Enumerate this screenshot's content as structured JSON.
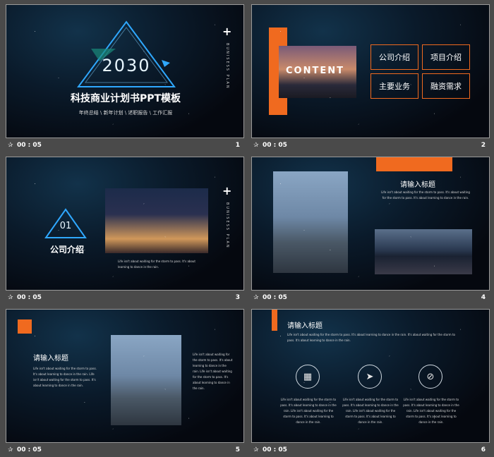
{
  "slides": [
    {
      "number": "1",
      "time": "00 : 05",
      "year": "2030",
      "title": "科技商业计划书PPT模板",
      "subtitle": "年终总结 \\ 新年计划 \\ 述职报告 \\ 工作汇报",
      "vertical": "BUNISESS PLAN"
    },
    {
      "number": "2",
      "time": "00 : 05",
      "content_label": "CONTENT",
      "menu": [
        "公司介绍",
        "项目介绍",
        "主要业务",
        "融资需求"
      ]
    },
    {
      "number": "3",
      "time": "00 : 05",
      "index": "01",
      "section": "公司介绍",
      "vertical": "BUNISESS PLAN",
      "body": "Life isn't about waiting for the storm to pass. It's about learning to dance in the rain."
    },
    {
      "number": "4",
      "time": "00 : 05",
      "heading": "请输入标题",
      "body": "Life isn't about waiting for the storm to pass. It's about waiting for the storm to pass. It's about learning to dance in the rain."
    },
    {
      "number": "5",
      "time": "00 : 05",
      "heading": "请输入标题",
      "left_body": "Life isn't about waiting for the storm to pass. It's about learning to dance in the rain. Life isn't about waiting for the storm to pass. It's about learning to dance in the rain.",
      "right_body": "Life isn't about waiting for the storm to pass. It's about learning to dance in the rain. Life isn't about waiting for the storm to pass. It's about learning to dance in the rain."
    },
    {
      "number": "6",
      "time": "00 : 05",
      "heading": "请输入标题",
      "intro": "Life isn't about waiting for the storm to pass. It's about learning to dance in the rain. It's about waiting for the storm to pass. It's about learning to dance in the rain.",
      "columns": [
        {
          "icon": "calculator-icon",
          "glyph": "▦",
          "text": "Life isn't about waiting for the storm to pass. It's about learning to dance in the rain. Life isn't about waiting for the storm to pass. It's about learning to dance in the rain."
        },
        {
          "icon": "paper-plane-icon",
          "glyph": "➤",
          "text": "Life isn't about waiting for the storm to pass. It's about learning to dance in the rain. Life isn't about waiting for the storm to pass. It's about learning to dance in the rain."
        },
        {
          "icon": "compass-icon",
          "glyph": "⊘",
          "text": "Life isn't about waiting for the storm to pass. It's about learning to dance in the rain. Life isn't about waiting for the storm to pass. It's about learning to dance in the rain."
        }
      ]
    }
  ],
  "colors": {
    "accent": "#f06a1f",
    "background": "#4a4a4a",
    "slide": "#05080f",
    "glow": "#2fa8ff"
  }
}
